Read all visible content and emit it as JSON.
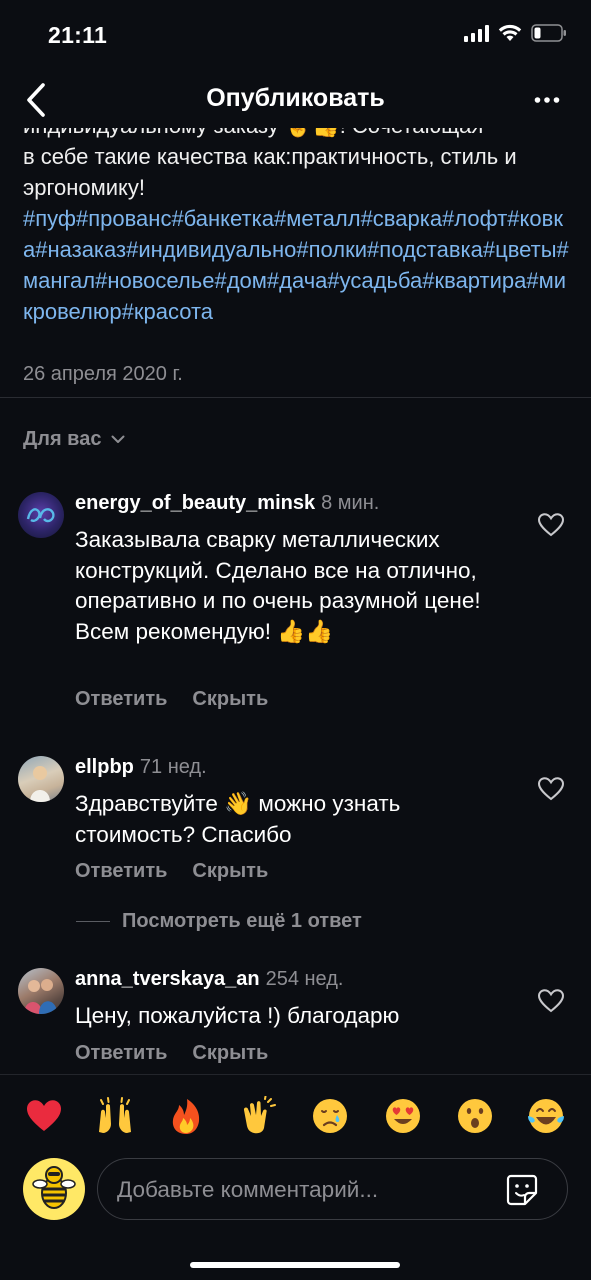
{
  "status_bar": {
    "time": "21:11"
  },
  "header": {
    "title": "Опубликовать"
  },
  "caption": {
    "partial_line": "индивидуальному заказу 🤞👍! Сочетающая",
    "text": "в себе такие качества как:практичность, стиль и эргономику!",
    "hashtags": "#пуф#прованс#банкетка#металл#сварка#лофт#ковка#назаказ#индивидуально#полки#подставка#цветы#мангал#новоселье#дом#дача#усадьба#квартира#микровелюр#красота",
    "date": "26 апреля 2020 г."
  },
  "filter": {
    "label": "Для вас"
  },
  "comments": [
    {
      "username": "energy_of_beauty_minsk",
      "time": "8 мин.",
      "text": "Заказывала сварку металлических конструкций. Сделано все на отлично, оперативно и по очень разумной цене! Всем рекомендую! 👍👍",
      "reply_label": "Ответить",
      "hide_label": "Скрыть"
    },
    {
      "username": "ellpbp",
      "time": "71 нед.",
      "text": "Здравствуйте 👋 можно узнать стоимость? Спасибо",
      "reply_label": "Ответить",
      "hide_label": "Скрыть"
    },
    {
      "username": "anna_tverskaya_an",
      "time": "254 нед.",
      "text": "Цену, пожалуйста !) благодарю",
      "reply_label": "Ответить",
      "hide_label": "Скрыть"
    }
  ],
  "more_replies": {
    "label": "Посмотреть ещё 1 ответ"
  },
  "reactions": [
    "❤️",
    "🙌",
    "🔥",
    "👏",
    "😢",
    "😍",
    "😮",
    "😂"
  ],
  "composer": {
    "placeholder": "Добавьте комментарий..."
  },
  "colors": {
    "background": "#0b0d12",
    "hashtag": "#7eb6ee",
    "secondary_text": "#8e8e93"
  }
}
